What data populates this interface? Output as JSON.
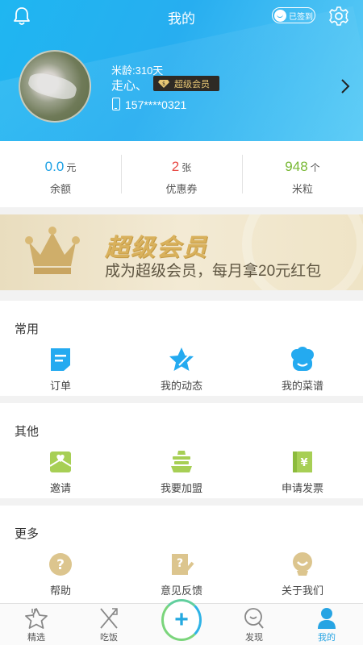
{
  "header": {
    "title": "我的",
    "signin_label": "已签到",
    "age": "米龄:310天",
    "nickname": "走心、",
    "vip_label": "超级会员",
    "phone": "157****0321",
    "colors": {
      "bg": "#27aef0",
      "vip_text": "#e8c775"
    },
    "icons": [
      "bell-icon",
      "settings-gear-icon",
      "phone-icon",
      "chevron-right-icon"
    ]
  },
  "stats": [
    {
      "value": "0.0",
      "unit": "元",
      "label": "余额",
      "color": "#1da1e5"
    },
    {
      "value": "2",
      "unit": "张",
      "label": "优惠券",
      "color": "#e84a45"
    },
    {
      "value": "948",
      "unit": "个",
      "label": "米粒",
      "color": "#78b834"
    }
  ],
  "banner": {
    "title": "超级会员",
    "subtitle": "成为超级会员，每月拿20元红包"
  },
  "sections": {
    "common": {
      "title": "常用",
      "items": [
        {
          "label": "订单",
          "icon": "order-icon"
        },
        {
          "label": "我的动态",
          "icon": "star-icon"
        },
        {
          "label": "我的菜谱",
          "icon": "chef-hat-icon"
        }
      ]
    },
    "other": {
      "title": "其他",
      "items": [
        {
          "label": "邀请",
          "icon": "invite-envelope-icon"
        },
        {
          "label": "我要加盟",
          "icon": "cart-icon"
        },
        {
          "label": "申请发票",
          "icon": "invoice-icon"
        }
      ]
    },
    "more": {
      "title": "更多",
      "items": [
        {
          "label": "帮助",
          "icon": "help-icon"
        },
        {
          "label": "意见反馈",
          "icon": "feedback-icon"
        },
        {
          "label": "关于我们",
          "icon": "about-icon"
        }
      ]
    }
  },
  "tabbar": {
    "items": [
      {
        "label": "精选",
        "icon": "featured-icon"
      },
      {
        "label": "吃饭",
        "icon": "fork-knife-icon"
      },
      {
        "label": "",
        "icon": "plus-icon"
      },
      {
        "label": "发现",
        "icon": "discover-icon"
      },
      {
        "label": "我的",
        "icon": "profile-icon",
        "active": true
      }
    ],
    "plus": "+"
  }
}
